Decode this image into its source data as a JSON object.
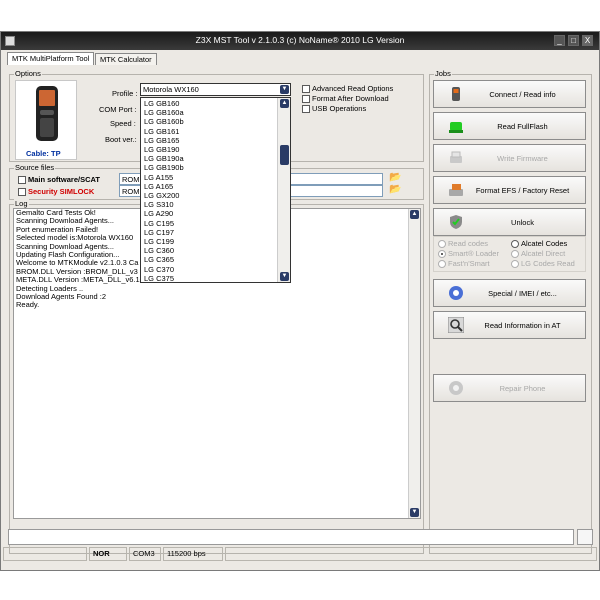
{
  "window": {
    "title": "Z3X MST Tool v 2.1.0.3 (c) NoName® 2010 LG Version",
    "controls": [
      "_",
      "□",
      "X"
    ]
  },
  "tabs": [
    "MTK MultiPlatform Tool",
    "MTK Calculator"
  ],
  "options": {
    "legend": "Options",
    "phone_label": "Cable: TP",
    "profile_label": "Profile :",
    "profile_value": "Motorola WX160",
    "comport_label": "COM Port :",
    "speed_label": "Speed :",
    "bootver_label": "Boot ver.:",
    "checkboxes": [
      "Advanced Read Options",
      "Format After Download",
      "USB Operations"
    ]
  },
  "profile_dropdown": [
    "LG GB160",
    "LG GB160a",
    "LG GB160b",
    "LG GB161",
    "LG GB165",
    "LG GB190",
    "LG GB190a",
    "LG GB190b",
    "LG A155",
    "LG A165",
    "LG GX200",
    "LG S310",
    "LG A290",
    "LG C195",
    "LG C197",
    "LG C199",
    "LG C360",
    "LG C365",
    "LG C370",
    "LG C375"
  ],
  "source_files": {
    "legend": "Source files",
    "rows": [
      {
        "label": "Main software/SCAT",
        "color": "#000000",
        "field": "ROM"
      },
      {
        "label": "Security SIMLOCK",
        "color": "#d00000",
        "field": "ROM"
      }
    ]
  },
  "log": {
    "legend": "Log",
    "lines": [
      "Gemalto Card Tests Ok!",
      "Scanning Download Agents...",
      "Port enumeration Failed!",
      "Selected model is:Motorola WX160",
      "Scanning Download Agents...",
      "Updating Flash Configuration...",
      "Welcome to MTKModule v2.1.0.3 Ca",
      "BROM.DLL Version :BROM_DLL_v3",
      "META.DLL Version :META_DLL_v6.1044.00 From 2012/03/26 12:52:38",
      "Detecting Loaders ..",
      "Download Agents Found :2",
      "Ready."
    ]
  },
  "jobs": {
    "legend": "Jobs",
    "buttons": [
      {
        "label": "Connect / Read info",
        "icon": "phone-icon",
        "enabled": true
      },
      {
        "label": "Read FullFlash",
        "icon": "green-light-icon",
        "enabled": true
      },
      {
        "label": "Write Firmware",
        "icon": "printer-icon",
        "enabled": false
      },
      {
        "label": "Format EFS / Factory Reset",
        "icon": "disk-tool-icon",
        "enabled": true
      },
      {
        "label": "Unlock",
        "icon": "shield-check-icon",
        "enabled": true
      },
      {
        "label": "Special / IMEI / etc...",
        "icon": "gear-blue-icon",
        "enabled": true
      },
      {
        "label": "Read Information in AT",
        "icon": "magnifier-icon",
        "enabled": true
      },
      {
        "label": "Repair Phone",
        "icon": "gear-gray-icon",
        "enabled": false
      }
    ],
    "radios": [
      {
        "label": "Read codes",
        "enabled": false,
        "selected": false
      },
      {
        "label": "Alcatel Codes",
        "enabled": true,
        "selected": false
      },
      {
        "label": "Smart® Loader",
        "enabled": false,
        "selected": true
      },
      {
        "label": "Alcatel Direct",
        "enabled": false,
        "selected": false
      },
      {
        "label": "Fast'n'Smart",
        "enabled": false,
        "selected": false
      },
      {
        "label": "LG Codes Read",
        "enabled": false,
        "selected": false
      }
    ]
  },
  "status": {
    "mode": "NOR",
    "port": "COM3",
    "baud": "115200 bps"
  },
  "colors": {
    "dropdown_scroll": "#2a3b66",
    "titlebar": "#2a2a2a",
    "led_green": "#22cc22"
  }
}
